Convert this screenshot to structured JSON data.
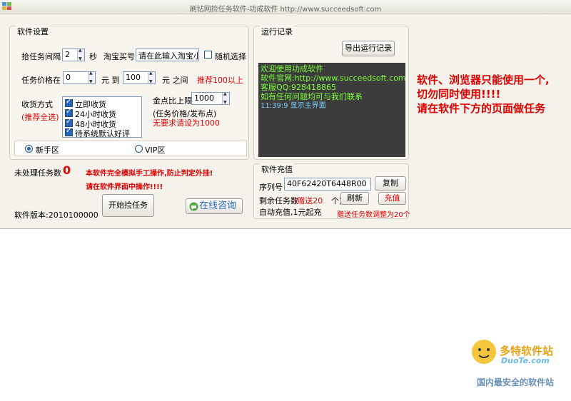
{
  "window": {
    "title": "刷钻网捡任务软件-功成软件 http://www.succeedsoft.com"
  },
  "settings": {
    "group_title": "软件设置",
    "interval_label": "拾任务间隔",
    "interval_value": "2",
    "interval_unit": "秒",
    "taobao_label": "淘宝买号",
    "taobao_placeholder": "请在此输入淘宝小号",
    "random_label": "随机选择",
    "price_label": "任务价格在",
    "price_min": "0",
    "price_to": "元 到",
    "price_max": "100",
    "price_between": "元 之间",
    "price_recommend": "推荐100以上",
    "receive_label": "收货方式",
    "receive_recommend": "(推荐全选)",
    "receive_options": [
      "立即收货",
      "24小时收货",
      "48小时收货",
      "待系统默认好评"
    ],
    "ratio_label": "金点比上限",
    "ratio_value": "1000",
    "ratio_desc": "(任务价格/发布点)",
    "ratio_hint": "无要求请设为1000",
    "zone_novice": "新手区",
    "zone_vip": "VIP区"
  },
  "log": {
    "group_title": "运行记录",
    "export_button": "导出运行记录",
    "lines": [
      "欢迎使用功成软件",
      "软件官网:http://www.succeedsoft.com",
      "客服QQ:928418865",
      "如有任何问题均可与我们联系",
      "11:39:9 显示主界面"
    ]
  },
  "status": {
    "pending_label": "未处理任务数",
    "pending_count": "0",
    "warning1": "本软件完全模拟手工操作,防止判定外挂!",
    "warning2": "请在软件界面中操作!!!!",
    "version": "软件版本:2010100000",
    "start_button": "开始捡任务",
    "online_button": "在线咨询"
  },
  "recharge": {
    "group_title": "软件充值",
    "serial_label": "序列号",
    "serial_value": "40F62420T6448R00",
    "copy_button": "复制",
    "remaining_label": "剩余任务数",
    "remaining_value": "(赠送20",
    "remaining_unit": "个)",
    "refresh_button": "刷新",
    "auto_label": "自动充值,1元起充",
    "charge_button": "充值",
    "bonus_note": "赠送任务数调整为20个"
  },
  "notice": [
    "软件、浏览器只能使用一个,",
    "切勿同时使用!!!!",
    "请在软件下方的页面做任务"
  ],
  "watermark": {
    "brand": "多特软件站",
    "domain": "DuoTe.com",
    "slogan": "国内最安全的软件站"
  },
  "colors": {
    "log_green": "#7cff3a",
    "log_cyan": "#7dd3ff",
    "alert_red": "#e00000"
  }
}
